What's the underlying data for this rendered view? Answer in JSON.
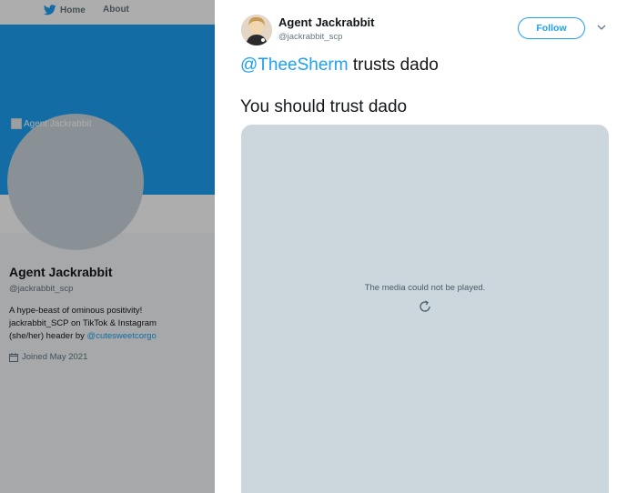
{
  "nav": {
    "home_label": "Home",
    "about_label": "About"
  },
  "profile": {
    "header_alt_text": "Agent Jackrabbit",
    "name": "Agent Jackrabbit",
    "handle": "@jackrabbit_scp",
    "bio_line1": "A hype-beast of ominous positivity!",
    "bio_line2": "jackrabbit_SCP on TikTok & Instagram",
    "bio_line3_prefix": "(she/her) header by ",
    "bio_line3_link": "@cutesweetcorgo",
    "joined": "Joined May 2021"
  },
  "tweet": {
    "author_name": "Agent Jackrabbit",
    "author_handle": "@jackrabbit_scp",
    "follow_label": "Follow",
    "mention": "@TheeSherm",
    "line1_rest": " trusts dado",
    "line2": "You should trust dado",
    "media_message": "The media could not be played."
  },
  "colors": {
    "brand_blue": "#1da1f2",
    "header_blue": "#1da1f2",
    "media_gray": "#ccd6dd"
  },
  "icons": {
    "nav_home": "twitter-bird-icon",
    "joined": "calendar-icon",
    "caret": "chevron-down-icon",
    "media": "reload-icon"
  }
}
